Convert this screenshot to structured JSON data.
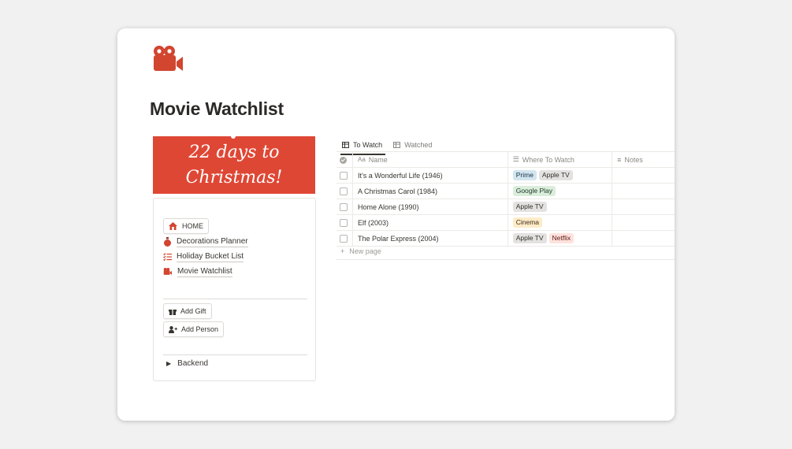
{
  "page": {
    "icon": "movie-camera-icon",
    "title": "Movie Watchlist"
  },
  "banner": {
    "text": "22 days to Christmas!"
  },
  "nav": {
    "items": [
      {
        "label": "HOME",
        "icon": "house-icon"
      },
      {
        "label": "Decorations Planner",
        "icon": "ornament-icon"
      },
      {
        "label": "Holiday Bucket List",
        "icon": "checklist-icon"
      },
      {
        "label": "Movie Watchlist",
        "icon": "movie-camera-icon"
      }
    ],
    "buttons": [
      {
        "label": "Add Gift",
        "icon": "gift-box-icon"
      },
      {
        "label": "Add Person",
        "icon": "add-person-icon"
      }
    ],
    "toggle": {
      "label": "Backend"
    }
  },
  "database": {
    "tabs": [
      {
        "label": "To Watch",
        "active": true
      },
      {
        "label": "Watched",
        "active": false
      }
    ],
    "columns": [
      "Name",
      "Where To Watch",
      "Notes"
    ],
    "rows": [
      {
        "name": "It's a Wonderful Life (1946)",
        "where": [
          {
            "label": "Prime",
            "color": "blue"
          },
          {
            "label": "Apple TV",
            "color": "gray"
          }
        ],
        "notes": ""
      },
      {
        "name": "A Christmas Carol (1984)",
        "where": [
          {
            "label": "Google Play",
            "color": "green"
          }
        ],
        "notes": ""
      },
      {
        "name": "Home Alone (1990)",
        "where": [
          {
            "label": "Apple TV",
            "color": "gray"
          }
        ],
        "notes": ""
      },
      {
        "name": "Elf (2003)",
        "where": [
          {
            "label": "Cinema",
            "color": "yellow"
          }
        ],
        "notes": ""
      },
      {
        "name": "The Polar Express (2004)",
        "where": [
          {
            "label": "Apple TV",
            "color": "gray"
          },
          {
            "label": "Netflix",
            "color": "red"
          }
        ],
        "notes": ""
      }
    ],
    "new_page": "New page"
  },
  "colors": {
    "accent": "#df4735",
    "tag_blue": "#d3e5ef",
    "tag_gray": "#e3e2e0",
    "tag_green": "#dbeddb",
    "tag_yellow": "#fdecc8",
    "tag_red": "#ffe2dd"
  }
}
